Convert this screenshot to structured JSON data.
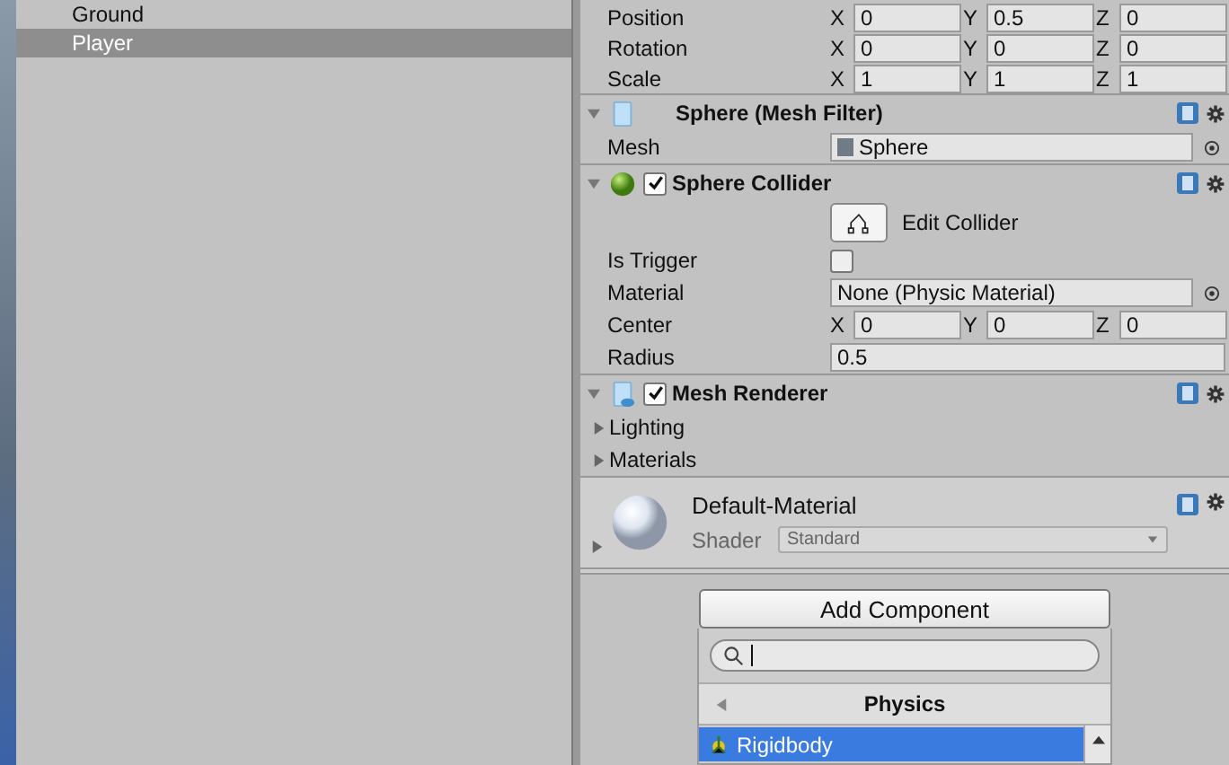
{
  "hierarchy": {
    "items": [
      {
        "label": "Ground",
        "selected": false
      },
      {
        "label": "Player",
        "selected": true
      }
    ]
  },
  "transform": {
    "rows": [
      {
        "label": "Position",
        "values": [
          {
            "axis": "X",
            "value": "0"
          },
          {
            "axis": "Y",
            "value": "0.5"
          },
          {
            "axis": "Z",
            "value": "0"
          }
        ]
      },
      {
        "label": "Rotation",
        "values": [
          {
            "axis": "X",
            "value": "0"
          },
          {
            "axis": "Y",
            "value": "0"
          },
          {
            "axis": "Z",
            "value": "0"
          }
        ]
      },
      {
        "label": "Scale",
        "values": [
          {
            "axis": "X",
            "value": "1"
          },
          {
            "axis": "Y",
            "value": "1"
          },
          {
            "axis": "Z",
            "value": "1"
          }
        ]
      }
    ]
  },
  "components": [
    {
      "kind": "mesh_filter",
      "title": "Sphere (Mesh Filter)",
      "fields": [
        {
          "kind": "object",
          "label": "Mesh",
          "value": "Sphere"
        }
      ]
    },
    {
      "kind": "collider",
      "title": "Sphere Collider",
      "enabled": true,
      "fields": [
        {
          "kind": "tool_button",
          "label": "Edit Collider"
        },
        {
          "kind": "checkbox",
          "label": "Is Trigger",
          "checked": false
        },
        {
          "kind": "object",
          "label": "Material",
          "value": "None (Physic Material)"
        },
        {
          "kind": "vector",
          "label": "Center",
          "values": [
            {
              "axis": "X",
              "value": "0"
            },
            {
              "axis": "Y",
              "value": "0"
            },
            {
              "axis": "Z",
              "value": "0"
            }
          ]
        },
        {
          "kind": "float",
          "label": "Radius",
          "value": "0.5"
        }
      ]
    },
    {
      "kind": "renderer",
      "title": "Mesh Renderer",
      "enabled": true,
      "fields": [
        {
          "kind": "foldout",
          "label": "Lighting",
          "expanded": false
        },
        {
          "kind": "foldout",
          "label": "Materials",
          "expanded": false
        }
      ]
    }
  ],
  "material": {
    "name": "Default-Material",
    "shader_label": "Shader",
    "shader": "Standard"
  },
  "add_component": {
    "button": "Add Component",
    "category": "Physics",
    "items": [
      {
        "label": "Rigidbody",
        "selected": true
      }
    ]
  }
}
